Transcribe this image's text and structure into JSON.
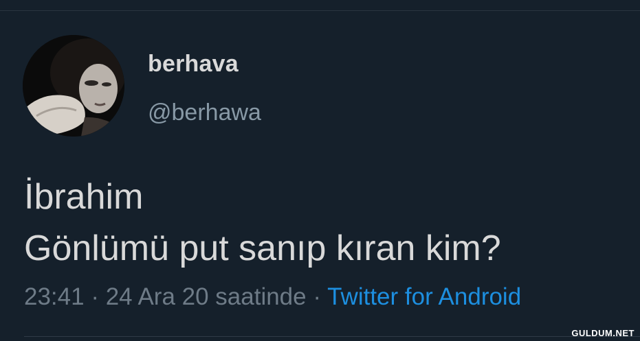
{
  "user": {
    "display_name": "berhava",
    "handle": "@berhawa"
  },
  "tweet": {
    "lines": [
      "İbrahim",
      "Gönlümü put sanıp kıran kim?"
    ],
    "time": "23:41",
    "separator": "·",
    "date": "24 Ara 20 saatinde",
    "source": "Twitter for Android"
  },
  "watermark": "GULDUM.NET",
  "colors": {
    "background": "#15202b",
    "text": "#d9d9d9",
    "secondary_text": "#8899a6",
    "link": "#1d8fe0"
  }
}
